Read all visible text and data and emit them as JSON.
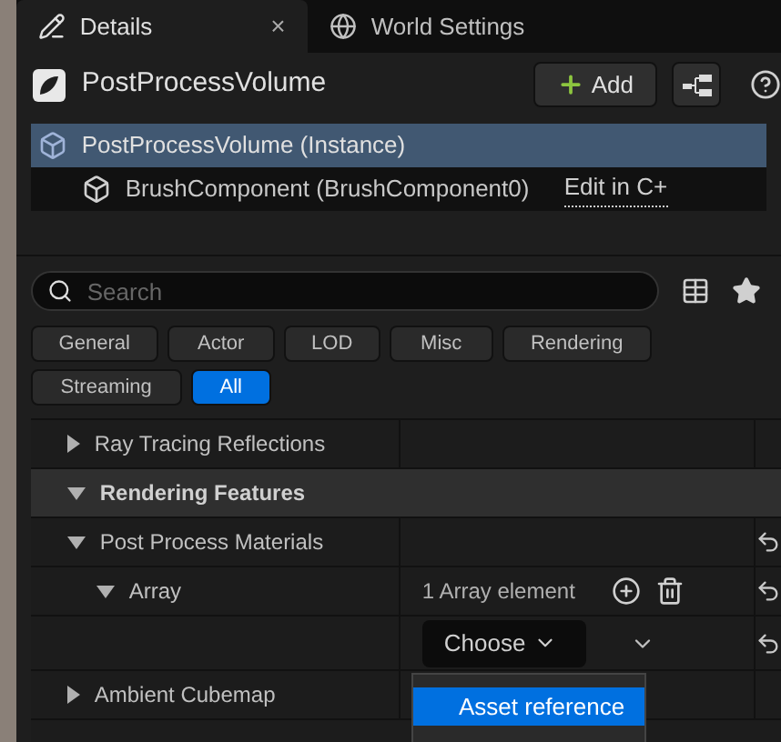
{
  "tabs": [
    {
      "label": "Details",
      "selected": true,
      "close": "×"
    },
    {
      "label": "World Settings",
      "selected": false
    }
  ],
  "header": {
    "title": "PostProcessVolume",
    "add_button": "Add"
  },
  "components": [
    {
      "label": "PostProcessVolume (Instance)",
      "selected": true,
      "children": [
        {
          "label": "BrushComponent (BrushComponent0)",
          "selected": false,
          "link": "Edit in C+"
        }
      ]
    }
  ],
  "search": {
    "placeholder": "Search"
  },
  "filters": [
    {
      "label": "General",
      "selected": false
    },
    {
      "label": "Actor",
      "selected": false
    },
    {
      "label": "LOD",
      "selected": false
    },
    {
      "label": "Misc",
      "selected": false
    },
    {
      "label": "Rendering",
      "selected": false
    },
    {
      "label": "Streaming",
      "selected": false
    },
    {
      "label": "All",
      "selected": true
    }
  ],
  "properties": [
    {
      "kind": "property",
      "label": "Ray Tracing Reflections",
      "expanded": false,
      "resettable": false
    },
    {
      "kind": "category",
      "label": "Rendering Features",
      "expanded": true,
      "children": [
        {
          "kind": "property",
          "label": "Post Process Materials",
          "expanded": true,
          "resettable": true,
          "children": [
            {
              "kind": "array",
              "label": "Array",
              "expanded": true,
              "value": "1 Array element",
              "resettable": true,
              "children": [
                {
                  "kind": "element",
                  "picker": "Choose",
                  "resettable": true
                }
              ]
            }
          ]
        },
        {
          "kind": "property",
          "label": "Ambient Cubemap",
          "expanded": false,
          "resettable": false
        }
      ]
    }
  ],
  "menu": {
    "items": [
      {
        "label": "Asset reference",
        "selected": true
      }
    ]
  }
}
